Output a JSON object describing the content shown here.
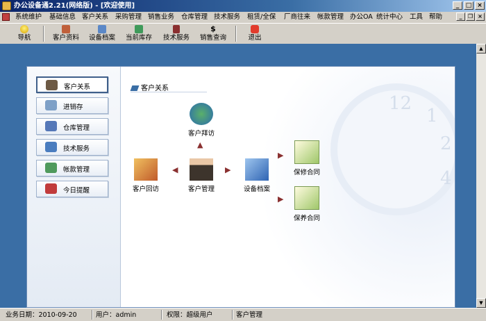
{
  "window": {
    "title": "办公设备通2.21(网络版) - [欢迎使用]"
  },
  "menu": [
    "系统维护",
    "基础信息",
    "客户关系",
    "采购管理",
    "销售业务",
    "仓库管理",
    "技术服务",
    "租赁/全保",
    "厂商往来",
    "帐款管理",
    "办公OA",
    "统计中心",
    "工具",
    "帮助"
  ],
  "toolbar": [
    "导航",
    "客户资料",
    "设备档案",
    "当前库存",
    "技术服务",
    "销售查询",
    "退出"
  ],
  "sidebar": [
    "客户关系",
    "进销存",
    "仓库管理",
    "技术服务",
    "帐款管理",
    "今日提醒"
  ],
  "section_title": "客户关系",
  "nodes": {
    "visit": "客户拜访",
    "return_visit": "客户回访",
    "manage": "客户管理",
    "equipment": "设备档案",
    "warranty": "保修合同",
    "maintenance": "保养合同"
  },
  "status": {
    "date": "业务日期：2010-09-20",
    "user": "用户：admin",
    "role": "权限：超级用户",
    "module": "客户管理"
  }
}
